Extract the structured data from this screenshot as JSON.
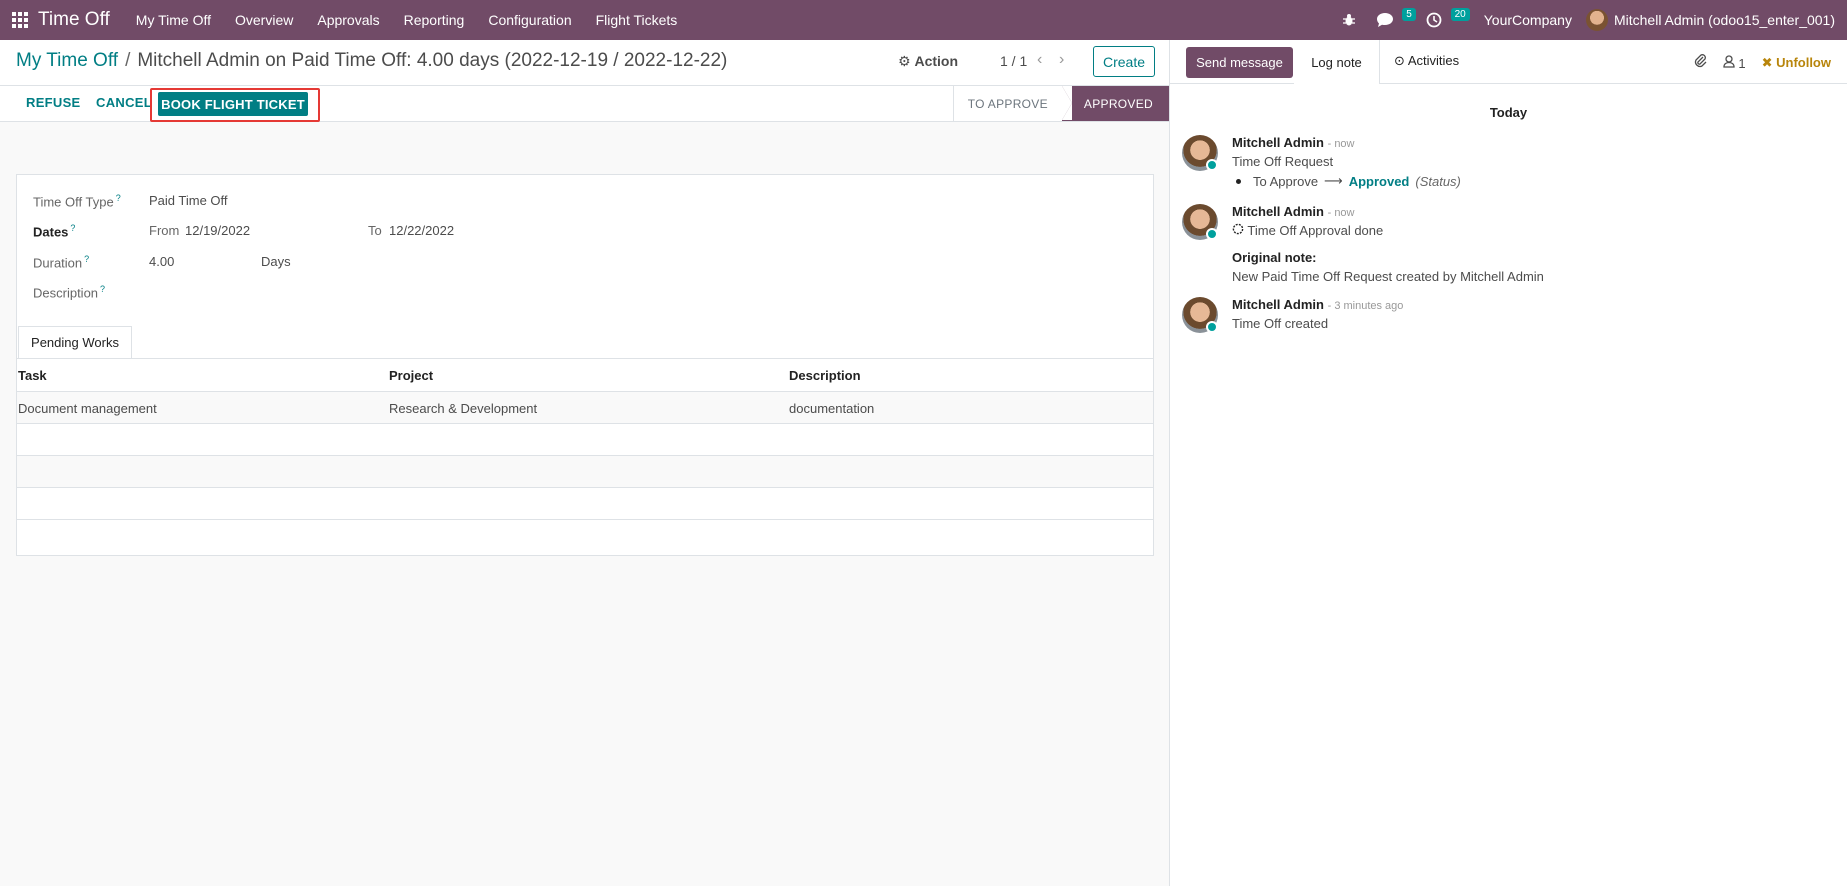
{
  "navbar": {
    "app_name": "Time Off",
    "menu": [
      "My Time Off",
      "Overview",
      "Approvals",
      "Reporting",
      "Configuration",
      "Flight Tickets"
    ],
    "messages_count": "5",
    "activities_count": "20",
    "company": "YourCompany",
    "user": "Mitchell Admin (odoo15_enter_001)"
  },
  "controlbar": {
    "breadcrumb_parent": "My Time Off",
    "breadcrumb_current": "Mitchell Admin on Paid Time Off: 4.00 days (2022-12-19 / 2022-12-22)",
    "action_label": "Action",
    "pager": "1 / 1",
    "create_label": "Create"
  },
  "statusbar": {
    "refuse_label": "REFUSE",
    "cancel_label": "CANCEL",
    "book_label": "BOOK FLIGHT TICKET",
    "stages": [
      "TO APPROVE",
      "APPROVED"
    ],
    "active_stage": "APPROVED"
  },
  "form": {
    "type_label": "Time Off Type",
    "type_value": "Paid Time Off",
    "dates_label": "Dates",
    "from_label": "From",
    "from_value": "12/19/2022",
    "to_label": "To",
    "to_value": "12/22/2022",
    "duration_label": "Duration",
    "duration_value": "4.00",
    "duration_unit": "Days",
    "description_label": "Description",
    "help_mark": "?"
  },
  "tabs": {
    "pending_works": "Pending Works"
  },
  "table": {
    "headers": [
      "Task",
      "Project",
      "Description"
    ],
    "rows": [
      [
        "Document management",
        "Research & Development",
        "documentation"
      ]
    ]
  },
  "chatter": {
    "send_message": "Send message",
    "log_note": "Log note",
    "activities": "Activities",
    "followers": "1",
    "unfollow": "Unfollow",
    "day_label": "Today",
    "messages": [
      {
        "author": "Mitchell Admin",
        "when": "- now",
        "title": "Time Off Request",
        "from_state": "To Approve",
        "arrow": "⟶",
        "to_state": "Approved",
        "field": "(Status)"
      },
      {
        "author": "Mitchell Admin",
        "when": "- now",
        "text": "Time Off Approval done",
        "note_label": "Original note:",
        "note": "New Paid Time Off Request created by Mitchell Admin"
      },
      {
        "author": "Mitchell Admin",
        "when": "- 3 minutes ago",
        "text": "Time Off created"
      }
    ]
  },
  "colors": {
    "brand": "#714b67",
    "accent": "#017e84",
    "highlight": "#e53935"
  }
}
